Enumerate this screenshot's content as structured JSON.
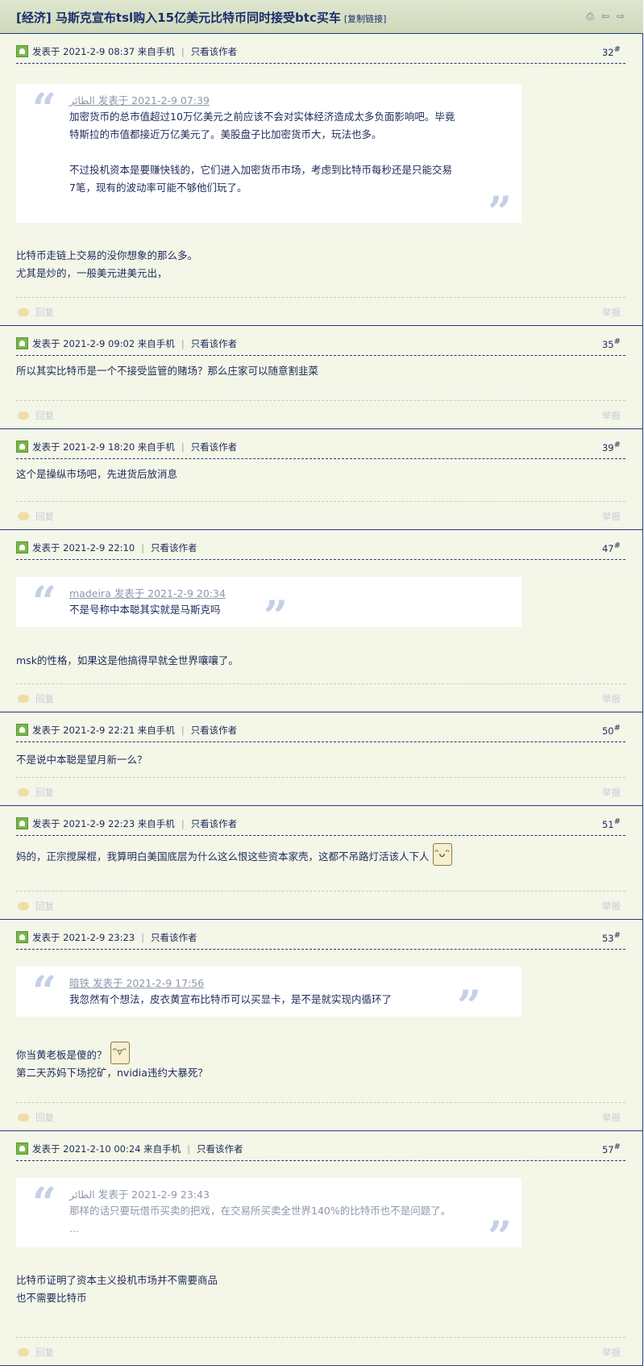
{
  "thread": {
    "title": "[经济] 马斯克宣布tsl购入15亿美元比特币同时接受btc买车",
    "copy_link": "[复制链接]"
  },
  "toolbar_icons": [
    "print-icon",
    "prev-arrow-icon",
    "next-arrow-icon"
  ],
  "labels": {
    "view_author": "只看该作者",
    "reply": "回复",
    "report": "举报"
  },
  "posts": [
    {
      "meta": "发表于 2021-2-9 08:37 来自手机",
      "floor": "32",
      "quote_author": "الطائر 发表于 2021-2-9 07:39",
      "quote_p1": "加密货币的总市值超过10万亿美元之前应该不会对实体经济造成太多负面影响吧。毕竟特斯拉的市值都接近万亿美元了。美股盘子比加密货币大，玩法也多。",
      "quote_p2": "不过投机资本是要赚快钱的，它们进入加密货币市场，考虑到比特币每秒还是只能交易7笔，现有的波动率可能不够他们玩了。",
      "body_l1": "比特币走链上交易的没你想象的那么多。",
      "body_l2": "尤其是炒的，一般美元进美元出，"
    },
    {
      "meta": "发表于 2021-2-9 09:02 来自手机",
      "floor": "35",
      "body_l1": "所以其实比特币是一个不接受监管的赌场？那么庄家可以随意割韭菜"
    },
    {
      "meta": "发表于 2021-2-9 18:20 来自手机",
      "floor": "39",
      "body_l1": "这个是操纵市场吧，先进货后放消息"
    },
    {
      "meta": "发表于 2021-2-9 22:10",
      "floor": "47",
      "quote_author": "madeira 发表于 2021-2-9 20:34",
      "quote_p1": "不是号称中本聪其实就是马斯克吗",
      "body_l1": "msk的性格，如果这是他搞得早就全世界嚷嚷了。"
    },
    {
      "meta": "发表于 2021-2-9 22:21 来自手机",
      "floor": "50",
      "body_l1": "不是说中本聪是望月新一么？"
    },
    {
      "meta": "发表于 2021-2-9 22:23 来自手机",
      "floor": "51",
      "body_l1": "妈的，正宗搅屎棍，我算明白美国底层为什么这么恨这些资本家壳，这都不吊路灯活该人下人"
    },
    {
      "meta": "发表于 2021-2-9 23:23",
      "floor": "53",
      "quote_author": "暗铁 发表于 2021-2-9 17:56",
      "quote_p1": "我忽然有个想法，皮衣黄宣布比特币可以买显卡，是不是就实现内循环了",
      "body_l1": "你当黄老板是傻的？",
      "body_l2": "第二天苏妈下场挖矿，nvidia违约大暴死？"
    },
    {
      "meta": "发表于 2021-2-10 00:24 来自手机",
      "floor": "57",
      "quote_author": "الطائر 发表于 2021-2-9 23:43",
      "quote_p1": "那样的话只要玩借币买卖的把戏，在交易所买卖全世界140%的比特币也不是问题了。 ...",
      "body_l1": "比特币证明了资本主义投机市场并不需要商品",
      "body_l2": "也不需要比特币"
    }
  ]
}
